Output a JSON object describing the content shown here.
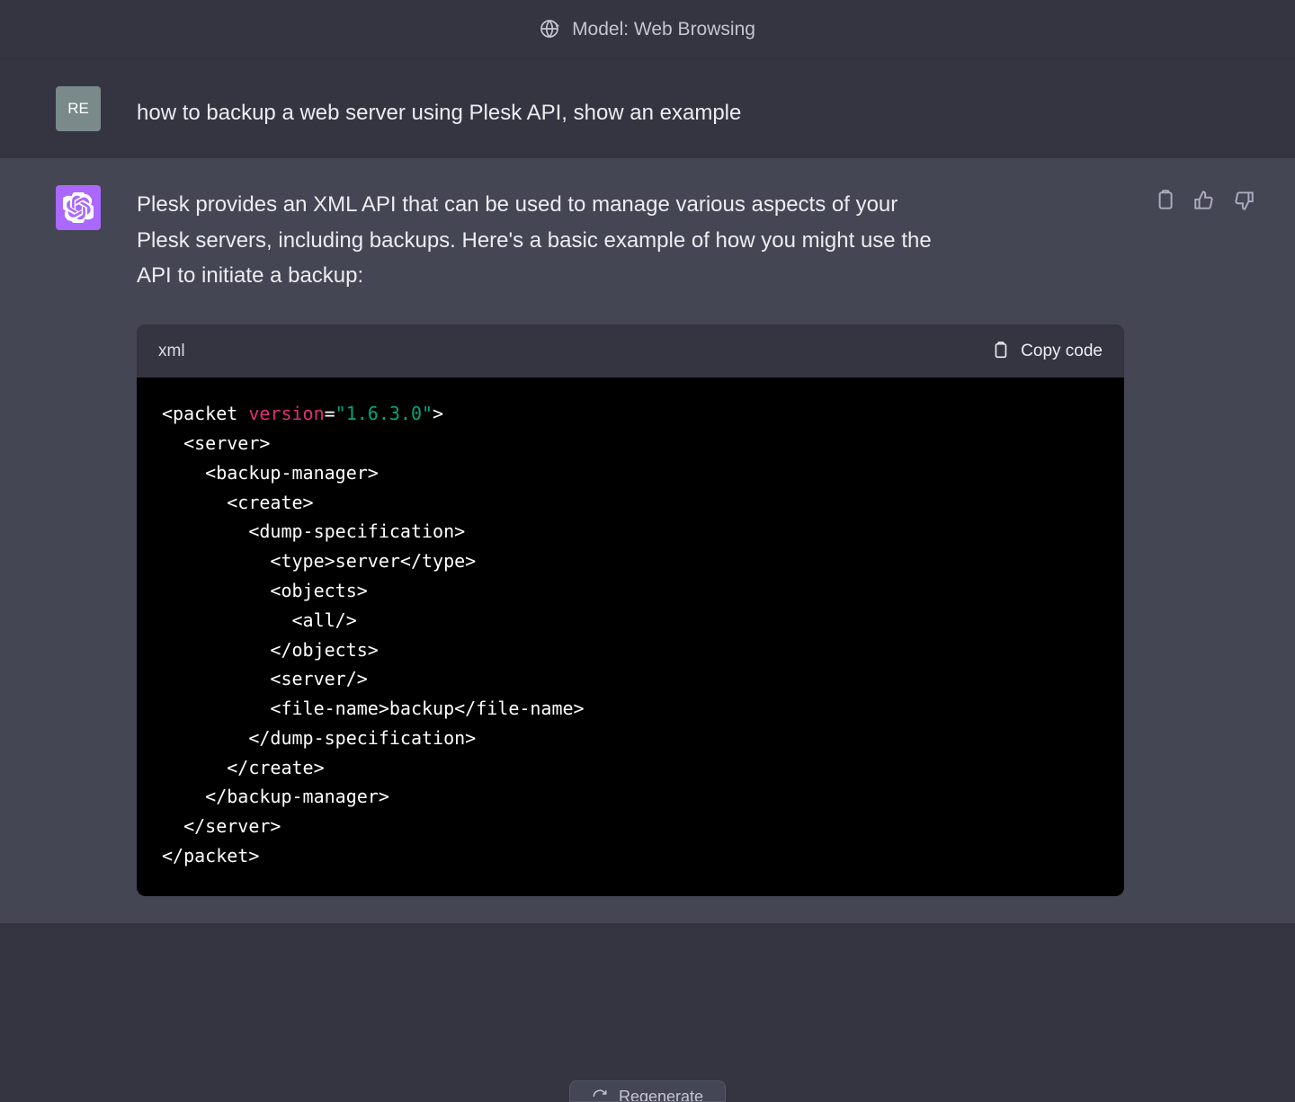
{
  "header": {
    "model_label": "Model: Web Browsing"
  },
  "user": {
    "initials": "RE",
    "message": "how to backup a web server using Plesk API, show an example"
  },
  "assistant": {
    "intro": "Plesk provides an XML API that can be used to manage various aspects of your Plesk servers, including backups. Here's a basic example of how you might use the API to initiate a backup:",
    "code_lang": "xml",
    "copy_label": "Copy code",
    "code_tokens": {
      "attr_version": "version",
      "str_version": "\"1.6.3.0\""
    },
    "code_lines": {
      "l1a": "<packet ",
      "l1b": "=",
      "l1c": ">",
      "l2": "  <server>",
      "l3": "    <backup-manager>",
      "l4": "      <create>",
      "l5": "        <dump-specification>",
      "l6": "          <type>server</type>",
      "l7": "          <objects>",
      "l8": "            <all/>",
      "l9": "          </objects>",
      "l10": "          <server/>",
      "l11": "          <file-name>backup</file-name>",
      "l12": "        </dump-specification>",
      "l13": "      </create>",
      "l14": "    </backup-manager>",
      "l15": "  </server>",
      "l16": "</packet>"
    }
  },
  "footer": {
    "regenerate_label": "Regenerate"
  }
}
